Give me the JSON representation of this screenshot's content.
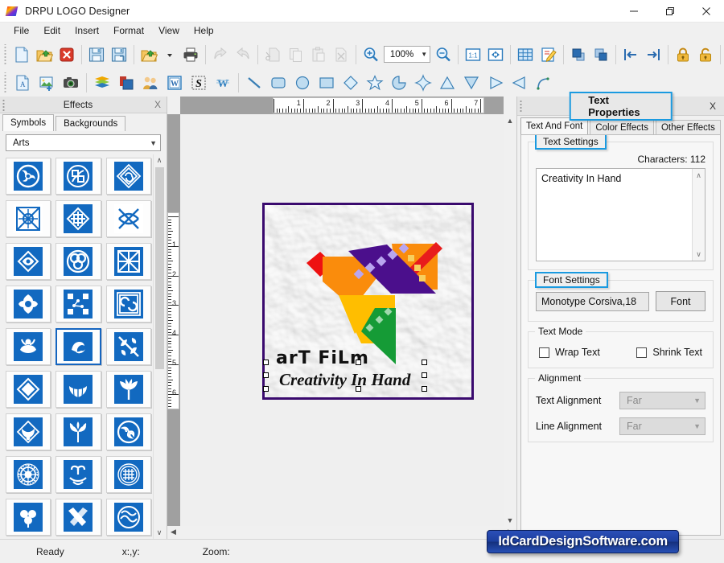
{
  "window": {
    "title": "DRPU LOGO Designer",
    "app_icon": "rainbow-logo-icon",
    "minimize_label": "—",
    "maximize_label": "❐",
    "close_label": "✕"
  },
  "menubar": {
    "items": [
      {
        "label": "File"
      },
      {
        "label": "Edit"
      },
      {
        "label": "Insert"
      },
      {
        "label": "Format"
      },
      {
        "label": "View"
      },
      {
        "label": "Help"
      }
    ]
  },
  "toolbar_main": {
    "zoom_value": "100%",
    "groups": [
      {
        "buttons": [
          {
            "name": "new-document-icon",
            "title": "New"
          },
          {
            "name": "open-folder-icon",
            "title": "Open"
          },
          {
            "name": "close-document-icon",
            "title": "Close"
          }
        ]
      },
      {
        "buttons": [
          {
            "name": "save-icon",
            "title": "Save"
          },
          {
            "name": "save-as-icon",
            "title": "Save As"
          }
        ]
      },
      {
        "buttons": [
          {
            "name": "open-recent-icon",
            "title": "Open Recent"
          },
          {
            "name": "print-icon",
            "title": "Print"
          }
        ]
      },
      {
        "buttons": [
          {
            "name": "undo-icon",
            "title": "Undo"
          },
          {
            "name": "redo-icon",
            "title": "Redo"
          }
        ]
      },
      {
        "buttons": [
          {
            "name": "cut-icon",
            "title": "Cut"
          },
          {
            "name": "copy-icon",
            "title": "Copy"
          },
          {
            "name": "paste-icon",
            "title": "Paste"
          },
          {
            "name": "delete-icon",
            "title": "Delete"
          }
        ]
      },
      {
        "buttons": [
          {
            "name": "zoom-in-icon",
            "title": "Zoom In"
          }
        ]
      },
      {
        "buttons": [
          {
            "name": "zoom-out-icon",
            "title": "Zoom Out"
          }
        ]
      },
      {
        "buttons": [
          {
            "name": "actual-size-icon",
            "title": "1:1"
          },
          {
            "name": "fit-to-window-icon",
            "title": "Fit To Window"
          }
        ]
      },
      {
        "buttons": [
          {
            "name": "grid-icon",
            "title": "Grid"
          },
          {
            "name": "edit-page-icon",
            "title": "Edit Page"
          }
        ]
      },
      {
        "buttons": [
          {
            "name": "bring-to-front-icon",
            "title": "Bring To Front"
          },
          {
            "name": "send-to-back-icon",
            "title": "Send To Back"
          }
        ]
      },
      {
        "buttons": [
          {
            "name": "align-left-icon",
            "title": "Align Left"
          },
          {
            "name": "align-right-icon",
            "title": "Align Right"
          }
        ]
      },
      {
        "buttons": [
          {
            "name": "lock-icon",
            "title": "Lock"
          },
          {
            "name": "unlock-icon",
            "title": "Unlock"
          }
        ]
      }
    ]
  },
  "toolbar_objects": {
    "buttons": [
      {
        "name": "add-text-icon",
        "title": "Text"
      },
      {
        "name": "add-image-icon",
        "title": "Image"
      },
      {
        "name": "camera-icon",
        "title": "Capture"
      },
      {
        "name": "layers-icon",
        "title": "Layers"
      },
      {
        "name": "shapes-icon",
        "title": "Shapes"
      },
      {
        "name": "contacts-icon",
        "title": "Contacts"
      },
      {
        "name": "word-art-icon",
        "title": "Word Art"
      },
      {
        "name": "signature-icon",
        "title": "Signature"
      },
      {
        "name": "watermark-icon",
        "title": "Watermark"
      },
      {
        "name": "line-tool-icon",
        "title": "Line"
      },
      {
        "name": "rounded-rect-tool-icon",
        "title": "Rounded Rectangle"
      },
      {
        "name": "ellipse-tool-icon",
        "title": "Ellipse"
      },
      {
        "name": "rectangle-tool-icon",
        "title": "Rectangle"
      },
      {
        "name": "diamond-tool-icon",
        "title": "Diamond"
      },
      {
        "name": "star-tool-icon",
        "title": "Star"
      },
      {
        "name": "pacman-tool-icon",
        "title": "Pie"
      },
      {
        "name": "four-point-star-tool-icon",
        "title": "Four Point Star"
      },
      {
        "name": "triangle-up-tool-icon",
        "title": "Triangle Up"
      },
      {
        "name": "triangle-down-tool-icon",
        "title": "Triangle Down"
      },
      {
        "name": "triangle-right-tool-icon",
        "title": "Triangle Right"
      },
      {
        "name": "triangle-left-tool-icon",
        "title": "Triangle Left"
      },
      {
        "name": "arc-tool-icon",
        "title": "Arc"
      }
    ]
  },
  "effects_panel": {
    "title": "Effects",
    "close_label": "X",
    "tabs": [
      {
        "label": "Symbols",
        "active": true
      },
      {
        "label": "Backgrounds",
        "active": false
      }
    ],
    "category": "Arts",
    "category_caret": "⌄",
    "scroll_up": "∧",
    "scroll_down": "∨",
    "symbols": [
      {
        "name": "triskelion-knot-symbol",
        "selected": false
      },
      {
        "name": "circular-interlace-symbol",
        "selected": false
      },
      {
        "name": "diamond-spiral-symbol",
        "selected": false
      },
      {
        "name": "square-celtic-cross-symbol",
        "selected": false
      },
      {
        "name": "diamond-cross-knot-symbol",
        "selected": false
      },
      {
        "name": "woven-x-knot-symbol",
        "selected": false
      },
      {
        "name": "double-loop-symbol",
        "selected": false
      },
      {
        "name": "trefoil-circle-symbol",
        "selected": false
      },
      {
        "name": "crossed-weave-symbol",
        "selected": false
      },
      {
        "name": "four-petal-knot-symbol",
        "selected": false
      },
      {
        "name": "dotted-network-symbol",
        "selected": false
      },
      {
        "name": "framed-swirl-symbol",
        "selected": false
      },
      {
        "name": "lotus-bloom-symbol",
        "selected": false
      },
      {
        "name": "curved-crest-symbol",
        "selected": true
      },
      {
        "name": "leaf-burst-symbol",
        "selected": false
      },
      {
        "name": "diamond-outline-symbol",
        "selected": false
      },
      {
        "name": "fan-shell-symbol",
        "selected": false
      },
      {
        "name": "palm-leaf-symbol",
        "selected": false
      },
      {
        "name": "diamond-fan-symbol",
        "selected": false
      },
      {
        "name": "oak-tree-symbol",
        "selected": false
      },
      {
        "name": "triple-spiral-symbol",
        "selected": false
      },
      {
        "name": "rosette-mandala-symbol",
        "selected": false
      },
      {
        "name": "scroll-ornament-symbol",
        "selected": false
      },
      {
        "name": "circular-crest-symbol",
        "selected": false
      },
      {
        "name": "clover-emblem-symbol",
        "selected": false
      },
      {
        "name": "crossed-tools-symbol",
        "selected": false
      },
      {
        "name": "circular-wave-symbol",
        "selected": false
      }
    ]
  },
  "canvas": {
    "h_ruler_labels": [
      "1",
      "2",
      "3",
      "4",
      "5",
      "6",
      "7"
    ],
    "v_ruler_labels": [
      "1",
      "2",
      "3",
      "4",
      "5",
      "6"
    ],
    "artwork": {
      "border_color": "#3a0a6e",
      "title_text": "arT FiLm",
      "tagline_text": "Creativity In Hand",
      "logo_name": "origami-bird-film-logo",
      "colors": {
        "red": "#ee1111",
        "orange": "#fa8c0c",
        "amber": "#ffbe00",
        "purple": "#4b0f8c",
        "green": "#159b36"
      }
    }
  },
  "text_properties": {
    "title": "Text Properties",
    "close_label": "X",
    "tabs": [
      {
        "label": "Text And Font",
        "active": true
      },
      {
        "label": "Color Effects",
        "active": false
      },
      {
        "label": "Other Effects",
        "active": false
      }
    ],
    "text_settings": {
      "legend": "Text Settings",
      "characters_label": "Characters: 112",
      "text_value": "Creativity In Hand",
      "scroll_up": "∧",
      "scroll_down": "∨"
    },
    "font_settings": {
      "legend": "Font Settings",
      "font_value": "Monotype Corsiva,18",
      "font_button": "Font"
    },
    "text_mode": {
      "legend": "Text Mode",
      "wrap_text_label": "Wrap Text",
      "wrap_text_checked": false,
      "shrink_text_label": "Shrink Text",
      "shrink_text_checked": false
    },
    "alignment": {
      "legend": "Alignment",
      "text_alignment_label": "Text Alignment",
      "text_alignment_value": "Far",
      "line_alignment_label": "Line Alignment",
      "line_alignment_value": "Far",
      "caret": "⌄"
    },
    "highlight_color": "#1a9ae0"
  },
  "statusbar": {
    "ready": "Ready",
    "coords": "x:,y:",
    "zoom": "Zoom:",
    "watermark": "IdCardDesignSoftware.com"
  }
}
